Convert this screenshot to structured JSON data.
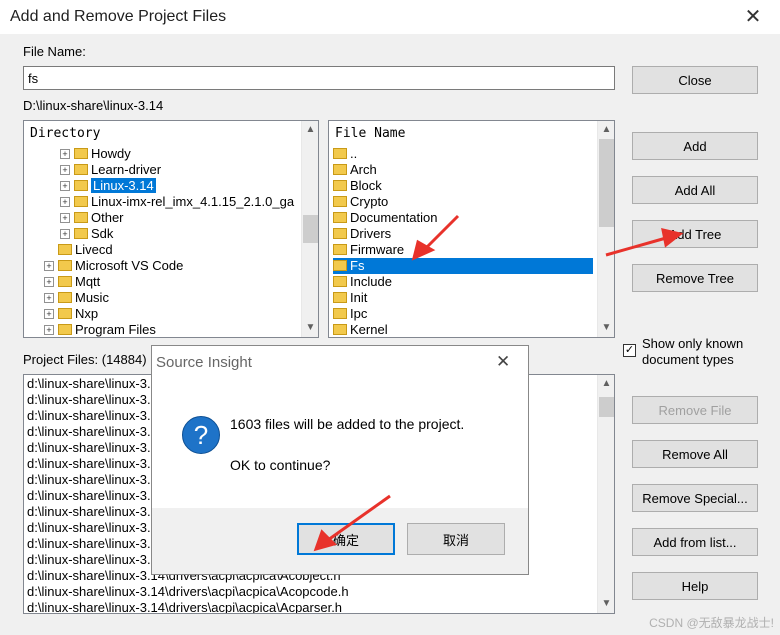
{
  "window": {
    "title": "Add and Remove Project Files",
    "close_glyph": "✕"
  },
  "file_name": {
    "label": "File Name:",
    "value": "fs"
  },
  "current_path": "D:\\linux-share\\linux-3.14",
  "directory": {
    "header": "Directory",
    "items": [
      {
        "label": "Howdy",
        "indent": 1,
        "expander": "+",
        "selected": false
      },
      {
        "label": "Learn-driver",
        "indent": 1,
        "expander": "+",
        "selected": false
      },
      {
        "label": "Linux-3.14",
        "indent": 1,
        "expander": "+",
        "selected": true
      },
      {
        "label": "Linux-imx-rel_imx_4.1.15_2.1.0_ga",
        "indent": 1,
        "expander": "+",
        "selected": false
      },
      {
        "label": "Other",
        "indent": 1,
        "expander": "+",
        "selected": false
      },
      {
        "label": "Sdk",
        "indent": 1,
        "expander": "+",
        "selected": false
      },
      {
        "label": "Livecd",
        "indent": 0,
        "expander": "",
        "selected": false
      },
      {
        "label": "Microsoft VS Code",
        "indent": 0,
        "expander": "+",
        "selected": false
      },
      {
        "label": "Mqtt",
        "indent": 0,
        "expander": "+",
        "selected": false
      },
      {
        "label": "Music",
        "indent": 0,
        "expander": "+",
        "selected": false
      },
      {
        "label": "Nxp",
        "indent": 0,
        "expander": "+",
        "selected": false
      },
      {
        "label": "Program Files",
        "indent": 0,
        "expander": "+",
        "selected": false
      }
    ]
  },
  "file_list": {
    "header": "File Name",
    "items": [
      {
        "label": "..",
        "selected": false
      },
      {
        "label": "Arch",
        "selected": false
      },
      {
        "label": "Block",
        "selected": false
      },
      {
        "label": "Crypto",
        "selected": false
      },
      {
        "label": "Documentation",
        "selected": false
      },
      {
        "label": "Drivers",
        "selected": false
      },
      {
        "label": "Firmware",
        "selected": false
      },
      {
        "label": "Fs",
        "selected": true
      },
      {
        "label": "Include",
        "selected": false
      },
      {
        "label": "Init",
        "selected": false
      },
      {
        "label": "Ipc",
        "selected": false
      },
      {
        "label": "Kernel",
        "selected": false
      }
    ]
  },
  "project_files": {
    "label": "Project Files: (14884)",
    "items": [
      "d:\\linux-share\\linux-3.1",
      "d:\\linux-share\\linux-3.1",
      "d:\\linux-share\\linux-3.1",
      "d:\\linux-share\\linux-3.1",
      "d:\\linux-share\\linux-3.1",
      "d:\\linux-share\\linux-3.1",
      "d:\\linux-share\\linux-3.1",
      "d:\\linux-share\\linux-3.1",
      "d:\\linux-share\\linux-3.1",
      "d:\\linux-share\\linux-3.1",
      "d:\\linux-share\\linux-3.1",
      "d:\\linux-share\\linux-3.1",
      "d:\\linux-share\\linux-3.14\\drivers\\acpi\\acpica\\Acobject.h",
      "d:\\linux-share\\linux-3.14\\drivers\\acpi\\acpica\\Acopcode.h",
      "d:\\linux-share\\linux-3.14\\drivers\\acpi\\acpica\\Acparser.h"
    ]
  },
  "buttons": {
    "close": "Close",
    "add": "Add",
    "add_all": "Add All",
    "add_tree": "Add Tree",
    "remove_tree": "Remove Tree",
    "remove_file": "Remove File",
    "remove_all": "Remove All",
    "remove_special": "Remove Special...",
    "add_from_list": "Add from list...",
    "help": "Help"
  },
  "show_known": {
    "label_line1": "Show only known",
    "label_line2": "document types",
    "checked": true
  },
  "dialog": {
    "title": "Source Insight",
    "close_glyph": "✕",
    "icon": "question-icon",
    "message": "1603 files will be added to the project.",
    "question": "OK to continue?",
    "ok_label": "确定",
    "cancel_label": "取消"
  },
  "watermark": "CSDN @无敌暴龙战士!",
  "colors": {
    "selection": "#0078d7",
    "arrow": "#e8322b"
  }
}
